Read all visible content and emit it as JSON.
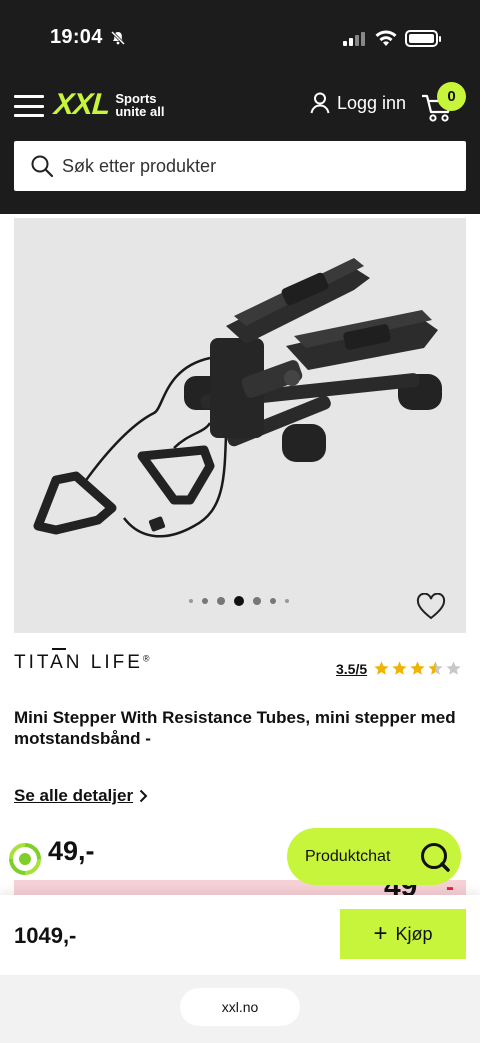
{
  "status_bar": {
    "time": "19:04",
    "bell_icon": "bell-slash-icon"
  },
  "header": {
    "logo": "XXL",
    "logo_tagline_1": "Sports",
    "logo_tagline_2": "unite all",
    "login_label": "Logg inn",
    "cart_count": "0",
    "search_placeholder": "Søk etter produkter"
  },
  "gallery": {
    "total_images": 7,
    "active_index": 3
  },
  "product": {
    "brand": "TITAN LIFE",
    "brand_mark": "®",
    "rating_text": "3.5/5",
    "rating_value": 3.5,
    "rating_max": 5,
    "title": "Mini Stepper With Resistance Tubes, mini stepper med motstandsbånd -",
    "details_link": "Se alle detaljer",
    "price_partial": "49,-"
  },
  "chat": {
    "label": "Produktchat"
  },
  "promo": {
    "fragment": "49",
    "fragment_red": "-"
  },
  "buy_bar": {
    "price": "1049,-",
    "buy_label": "Kjøp"
  },
  "browser": {
    "url": "xxl.no"
  },
  "colors": {
    "accent": "#c7f53b",
    "header_bg": "#1c1c1c",
    "star": "#f0b400",
    "promo_red": "#e8213a"
  }
}
